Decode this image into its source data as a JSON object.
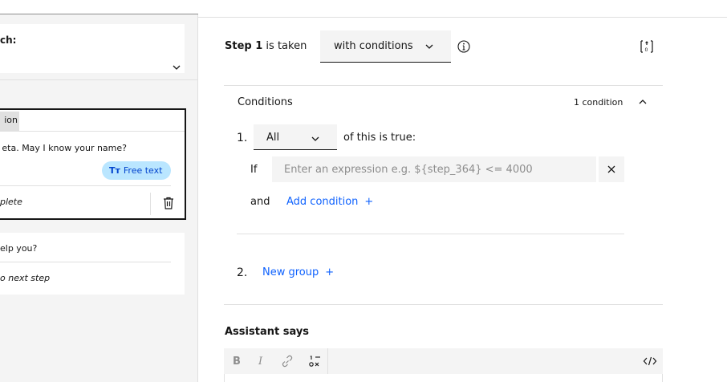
{
  "left": {
    "match_label": "ch:",
    "step_tag": "ion",
    "step_message": "eta. May I know your name?",
    "response_type": "Free text",
    "response_type_icon": "text-type-icon",
    "step_action": "plete",
    "next_question": "elp you?",
    "next_action": "o next step"
  },
  "step": {
    "name": "Step 1",
    "suffix": "is taken",
    "condition_mode": "with conditions"
  },
  "conditions": {
    "title": "Conditions",
    "count": "1 condition",
    "group1_number": "1.",
    "group1_match": "All",
    "group1_suffix": "of this is true:",
    "if_label": "If",
    "expression_placeholder": "Enter an expression e.g. ${step_364} <= 4000",
    "expression_value": "",
    "and_label": "and",
    "add_condition": "Add condition",
    "group2_number": "2.",
    "new_group": "New group"
  },
  "assistant": {
    "title": "Assistant says",
    "toolbar": {
      "bold": "B",
      "italic": "I"
    }
  },
  "colors": {
    "link": "#0f62fe",
    "chip_bg": "#bae6ff",
    "chip_text": "#0043ce"
  }
}
